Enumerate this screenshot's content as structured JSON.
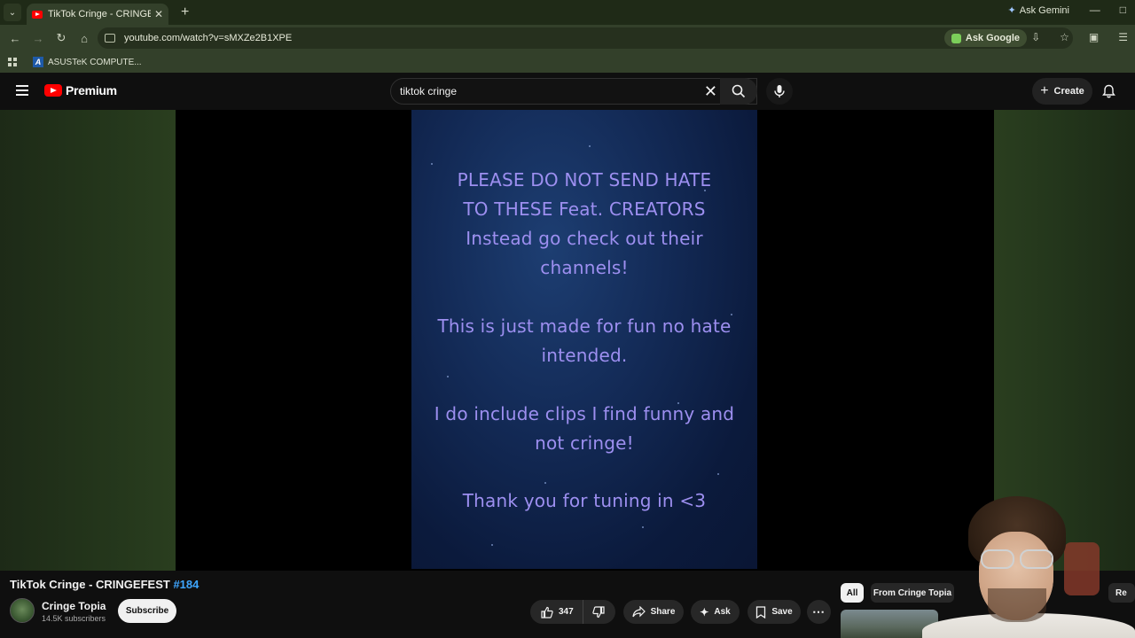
{
  "browser": {
    "tab_title": "TikTok Cringe - CRINGEFEST #1",
    "ask_gemini": "Ask Gemini",
    "url": "youtube.com/watch?v=sMXZe2B1XPE",
    "ask_google": "Ask Google",
    "bookmark": "ASUSTeK COMPUTE..."
  },
  "header": {
    "logo_text": "Premium",
    "search_value": "tiktok cringe",
    "create_label": "Create"
  },
  "video": {
    "overlay_lines": [
      "PLEASE DO NOT SEND HATE",
      "TO THESE Feat. CREATORS",
      "Instead go check out their",
      "channels!",
      "This is just made for fun no hate",
      "intended.",
      "I do include clips I find funny  and",
      "not cringe!",
      "Thank you for tuning in <3"
    ],
    "title": "TikTok Cringe - CRINGEFEST",
    "title_hashtag": "#184"
  },
  "channel": {
    "name": "Cringe Topia",
    "subscribers": "14.5K subscribers",
    "subscribe_label": "Subscribe"
  },
  "actions": {
    "likes": "347",
    "share_label": "Share",
    "ask_label": "Ask",
    "save_label": "Save"
  },
  "chips": {
    "all": "All",
    "from_channel": "From Cringe Topia",
    "related": "Re"
  },
  "colors": {
    "accent_red": "#ff0000",
    "hashtag_blue": "#3ea6ff",
    "overlay_text": "#9d8ff0"
  }
}
